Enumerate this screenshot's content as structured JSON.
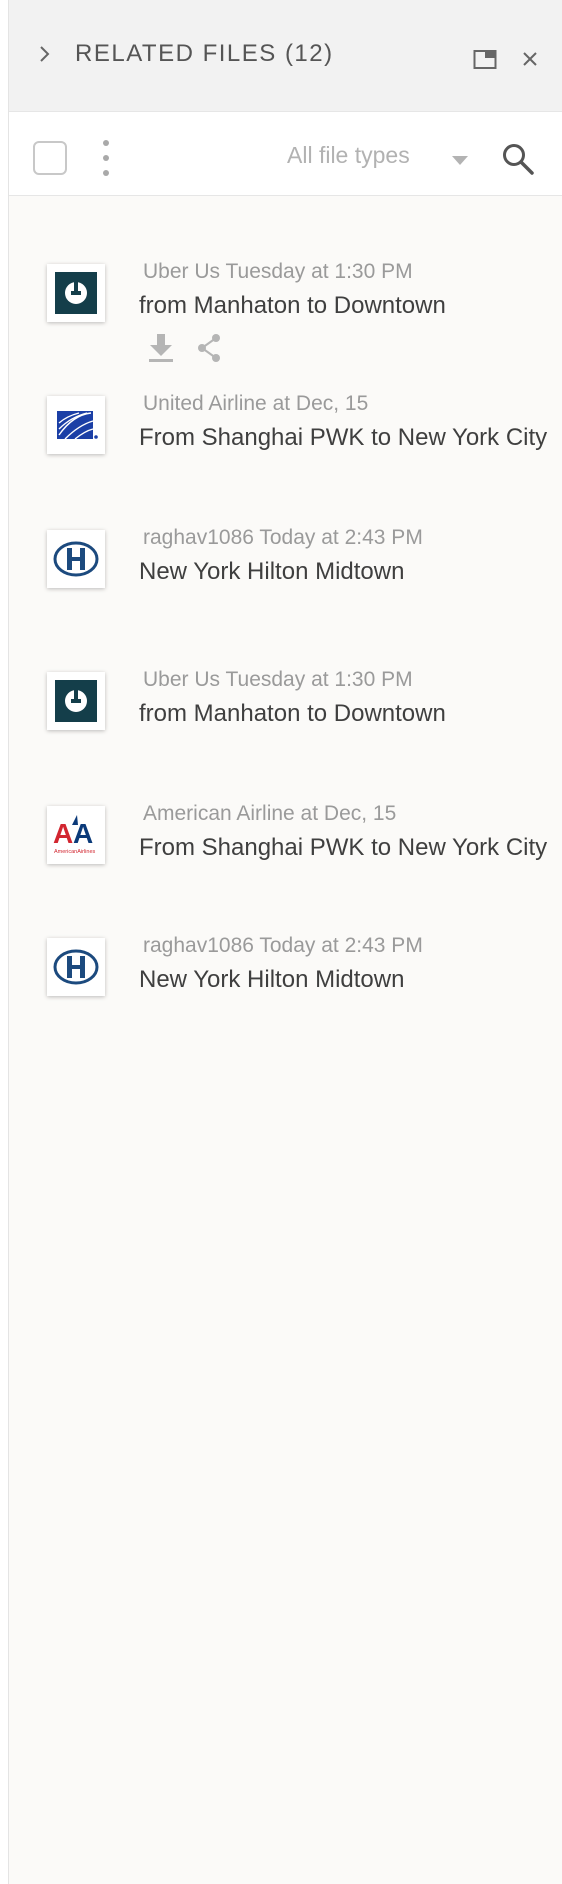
{
  "header": {
    "title": "RELATED FILES (12)",
    "icons": [
      "chevron-right-icon",
      "popout-window-icon",
      "close-icon"
    ]
  },
  "toolbar": {
    "filter_label": "All file types",
    "icons": [
      "select-all-checkbox",
      "more-vertical-icon",
      "caret-down-icon",
      "search-icon"
    ]
  },
  "files": [
    {
      "logo": "uber",
      "meta": "Uber Us Tuesday at 1:30 PM",
      "name": "from Manhaton to Downtown",
      "actions": [
        "download-icon",
        "share-icon"
      ]
    },
    {
      "logo": "united",
      "meta": "United Airline at Dec, 15",
      "name": "From Shanghai PWK to New York City"
    },
    {
      "logo": "hilton",
      "meta": "raghav1086 Today at 2:43 PM",
      "name": "New York Hilton Midtown"
    },
    {
      "logo": "uber",
      "meta": "Uber Us Tuesday at 1:30 PM",
      "name": "from Manhaton to Downtown"
    },
    {
      "logo": "american",
      "meta": "American Airline at Dec, 15",
      "name": "From Shanghai PWK to New York City",
      "logo_text": "AmericanAirlines"
    },
    {
      "logo": "hilton",
      "meta": "raghav1086 Today at 2:43 PM",
      "name": "New York Hilton Midtown"
    }
  ],
  "colors": {
    "header_bg": "#f2f2f2",
    "panel_bg": "#fbfaf8",
    "uber_teal": "#143e4a",
    "united_blue": "#1b3fa6",
    "hilton_navy": "#1c4a7e",
    "american_red": "#d22630",
    "american_blue": "#0b3a79"
  }
}
